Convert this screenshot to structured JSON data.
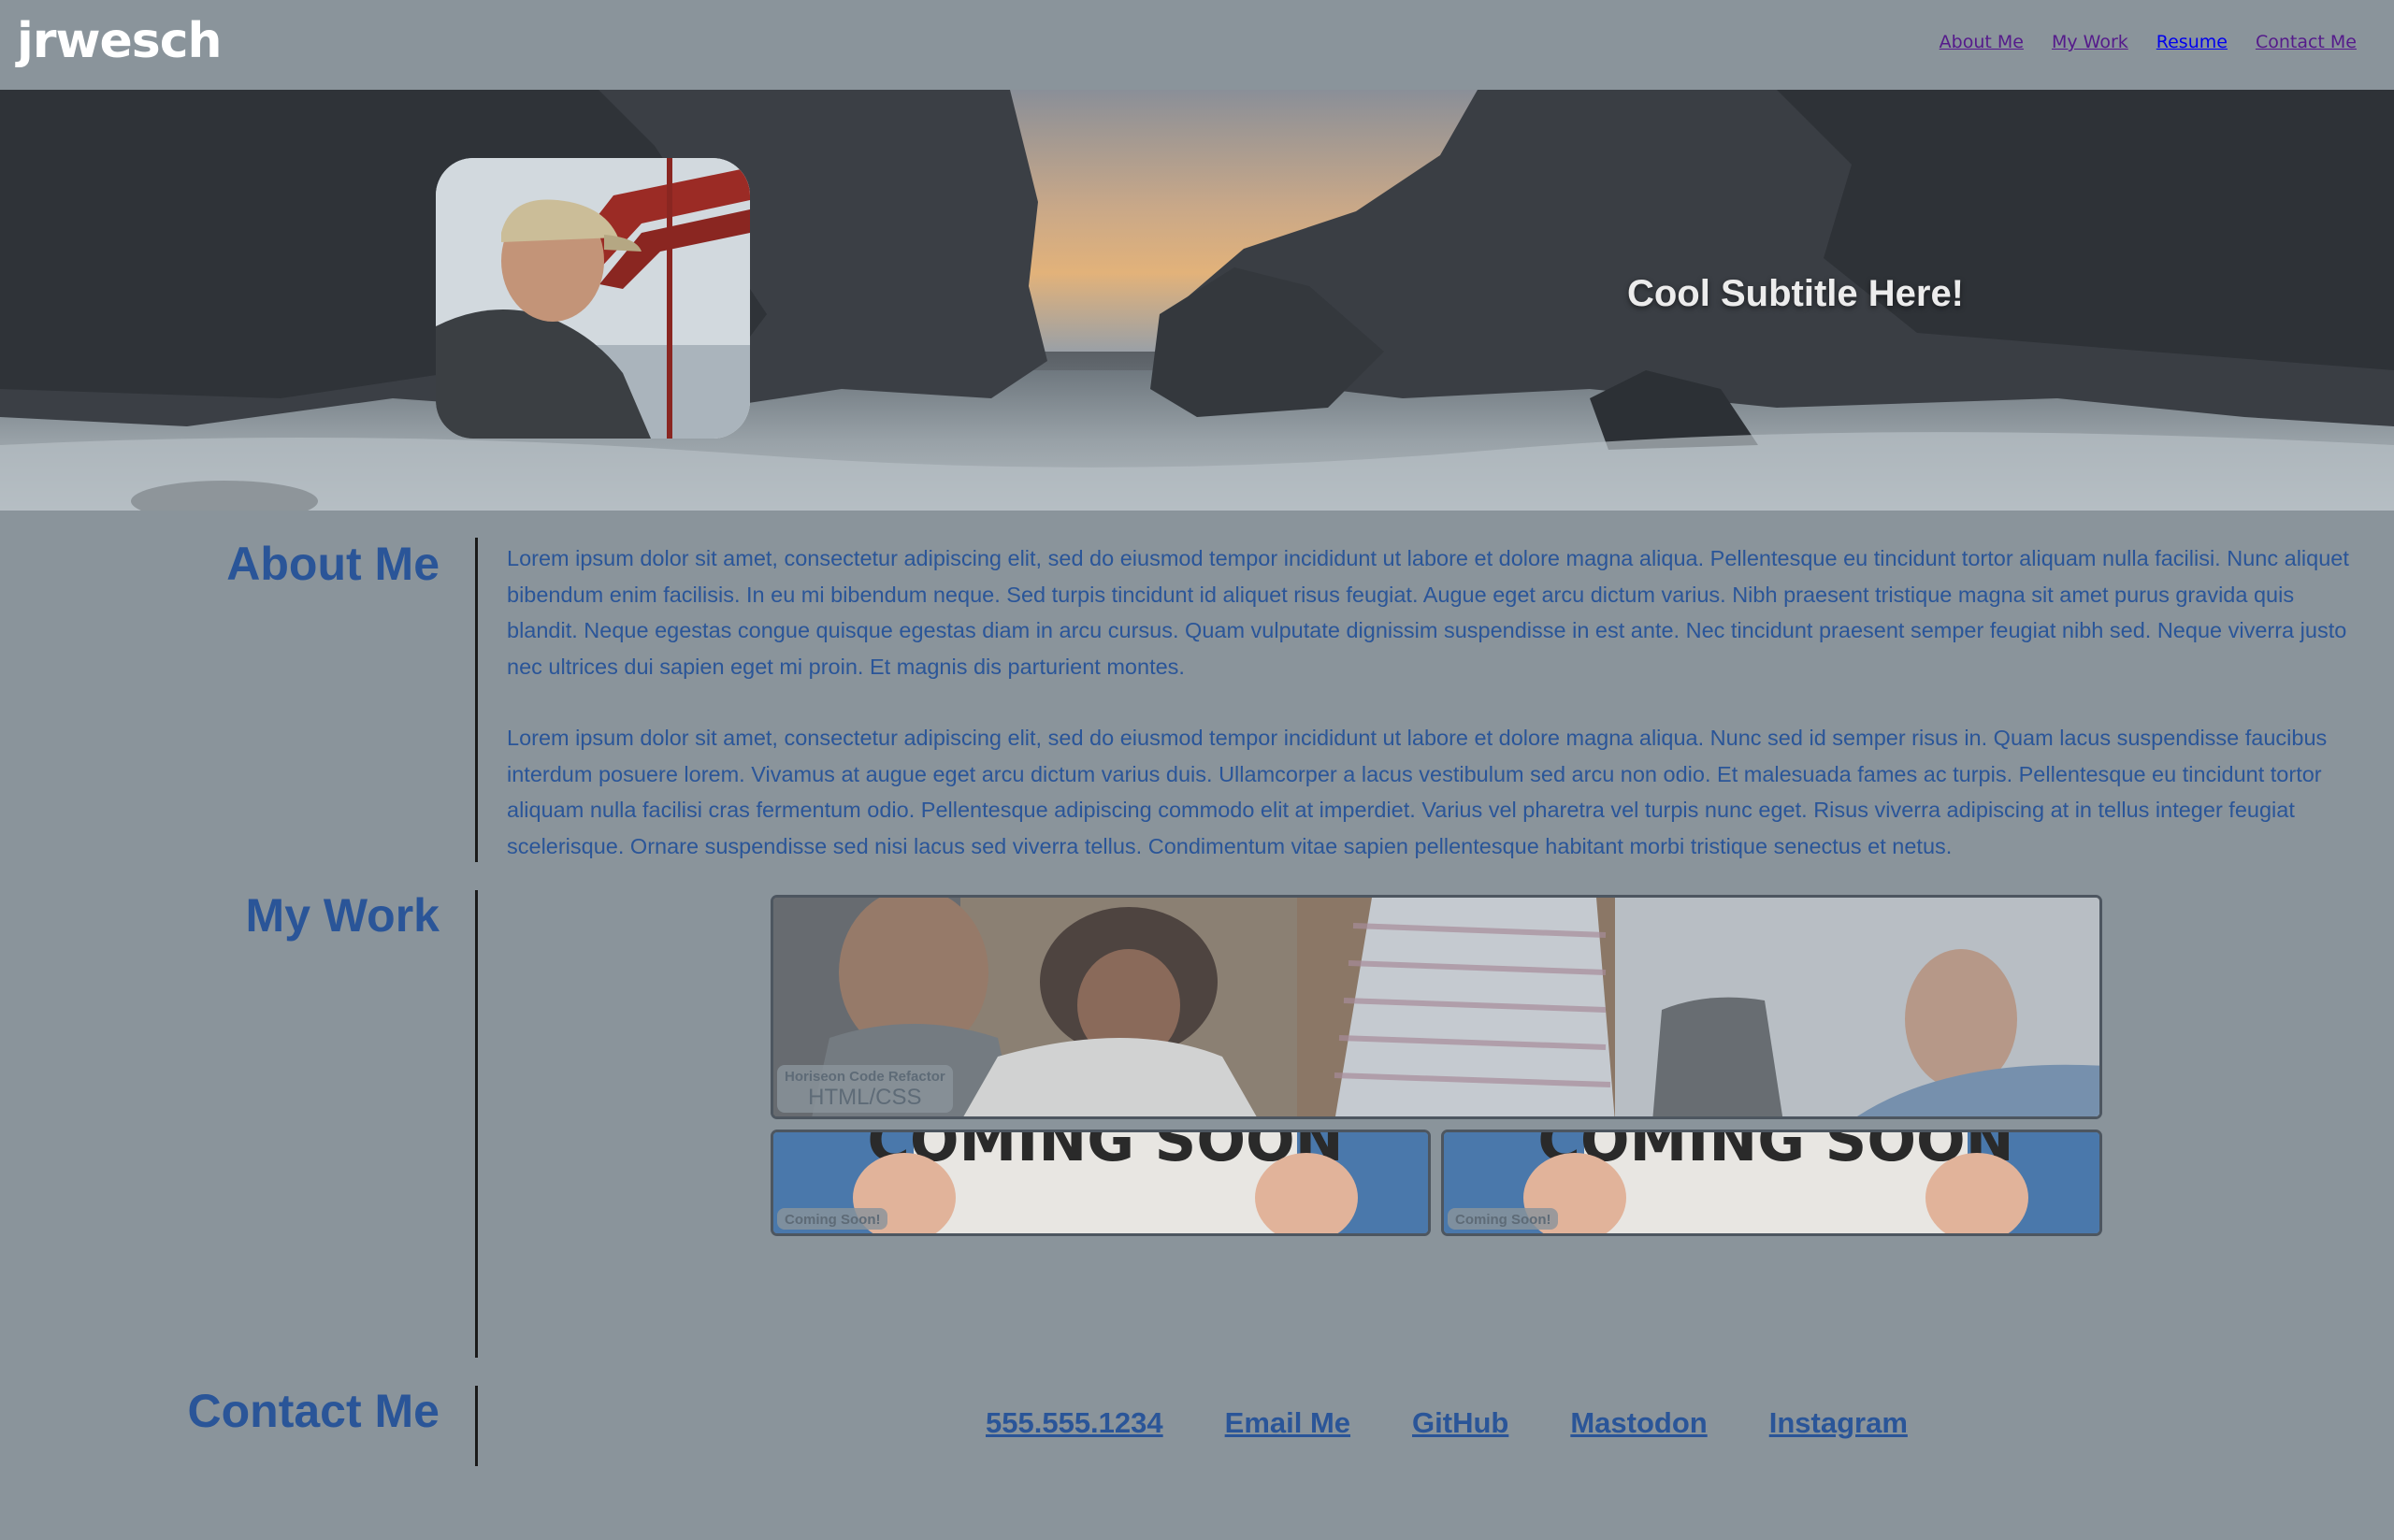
{
  "header": {
    "logo": "jrwesch",
    "nav": [
      {
        "label": "About Me"
      },
      {
        "label": "My Work"
      },
      {
        "label": "Resume"
      },
      {
        "label": "Contact Me"
      }
    ]
  },
  "hero": {
    "subtitle": "Cool Subtitle Here!"
  },
  "about": {
    "title": "About Me",
    "paragraphs": [
      "Lorem ipsum dolor sit amet, consectetur adipiscing elit, sed do eiusmod tempor incididunt ut labore et dolore magna aliqua. Pellentesque eu tincidunt tortor aliquam nulla facilisi. Nunc aliquet bibendum enim facilisis. In eu mi bibendum neque. Sed turpis tincidunt id aliquet risus feugiat. Augue eget arcu dictum varius. Nibh praesent tristique magna sit amet purus gravida quis blandit. Neque egestas congue quisque egestas diam in arcu cursus. Quam vulputate dignissim suspendisse in est ante. Nec tincidunt praesent semper feugiat nibh sed. Neque viverra justo nec ultrices dui sapien eget mi proin. Et magnis dis parturient montes.",
      "Lorem ipsum dolor sit amet, consectetur adipiscing elit, sed do eiusmod tempor incididunt ut labore et dolore magna aliqua. Nunc sed id semper risus in. Quam lacus suspendisse faucibus interdum posuere lorem. Vivamus at augue eget arcu dictum varius duis. Ullamcorper a lacus vestibulum sed arcu non odio. Et malesuada fames ac turpis. Pellentesque eu tincidunt tortor aliquam nulla facilisi cras fermentum odio. Pellentesque adipiscing commodo elit at imperdiet. Varius vel pharetra vel turpis nunc eget. Risus viverra adipiscing at in tellus integer feugiat scelerisque. Ornare suspendisse sed nisi lacus sed viverra tellus. Condimentum vitae sapien pellentesque habitant morbi tristique senectus et netus."
    ]
  },
  "work": {
    "title": "My Work",
    "featured": {
      "name": "Horiseon Code Refactor",
      "tech": "HTML/CSS"
    },
    "coming_soon": [
      {
        "label": "Coming Soon!",
        "sign": "COMING SOON"
      },
      {
        "label": "Coming Soon!",
        "sign": "COMING SOON"
      }
    ]
  },
  "contact": {
    "title": "Contact Me",
    "links": [
      {
        "label": "555.555.1234"
      },
      {
        "label": "Email Me"
      },
      {
        "label": "GitHub"
      },
      {
        "label": "Mastodon"
      },
      {
        "label": "Instagram"
      }
    ]
  },
  "colors": {
    "page_bg": "#8a949b",
    "heading": "#2a5598",
    "divider": "#1a1a1a",
    "card_border": "#4d5660"
  }
}
